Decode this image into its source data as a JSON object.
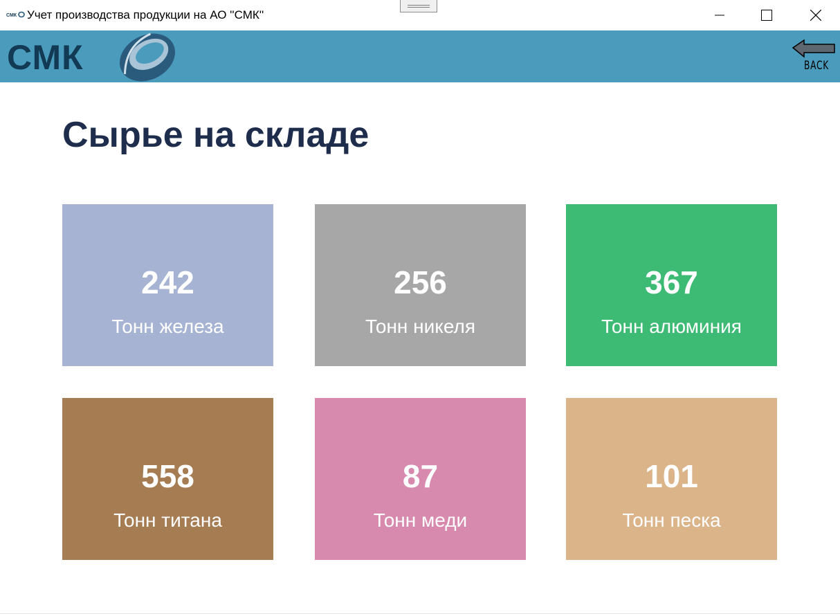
{
  "window": {
    "title": "Учет производства продукции на АО ''СМК''",
    "app_icon": "smk-mini-logo-icon",
    "controls": [
      "minimize-icon",
      "maximize-icon",
      "close-icon"
    ]
  },
  "header": {
    "logo_text": "СМК",
    "back_label": "BACK",
    "back_icon": "arrow-left-icon"
  },
  "page": {
    "title": "Сырье на складе"
  },
  "cards": [
    {
      "value": "242",
      "label": "Тонн железа",
      "color": "#a7b3d3"
    },
    {
      "value": "256",
      "label": "Тонн никеля",
      "color": "#a7a7a7"
    },
    {
      "value": "367",
      "label": "Тонн алюминия",
      "color": "#3dba74"
    },
    {
      "value": "558",
      "label": "Тонн титана",
      "color": "#a67c52"
    },
    {
      "value": "87",
      "label": "Тонн меди",
      "color": "#d78aae"
    },
    {
      "value": "101",
      "label": "Тонн песка",
      "color": "#dbb48a"
    }
  ],
  "colors": {
    "header_bg": "#4b9bbd",
    "title_text": "#1f2d4d",
    "logo_dark": "#133a55"
  }
}
